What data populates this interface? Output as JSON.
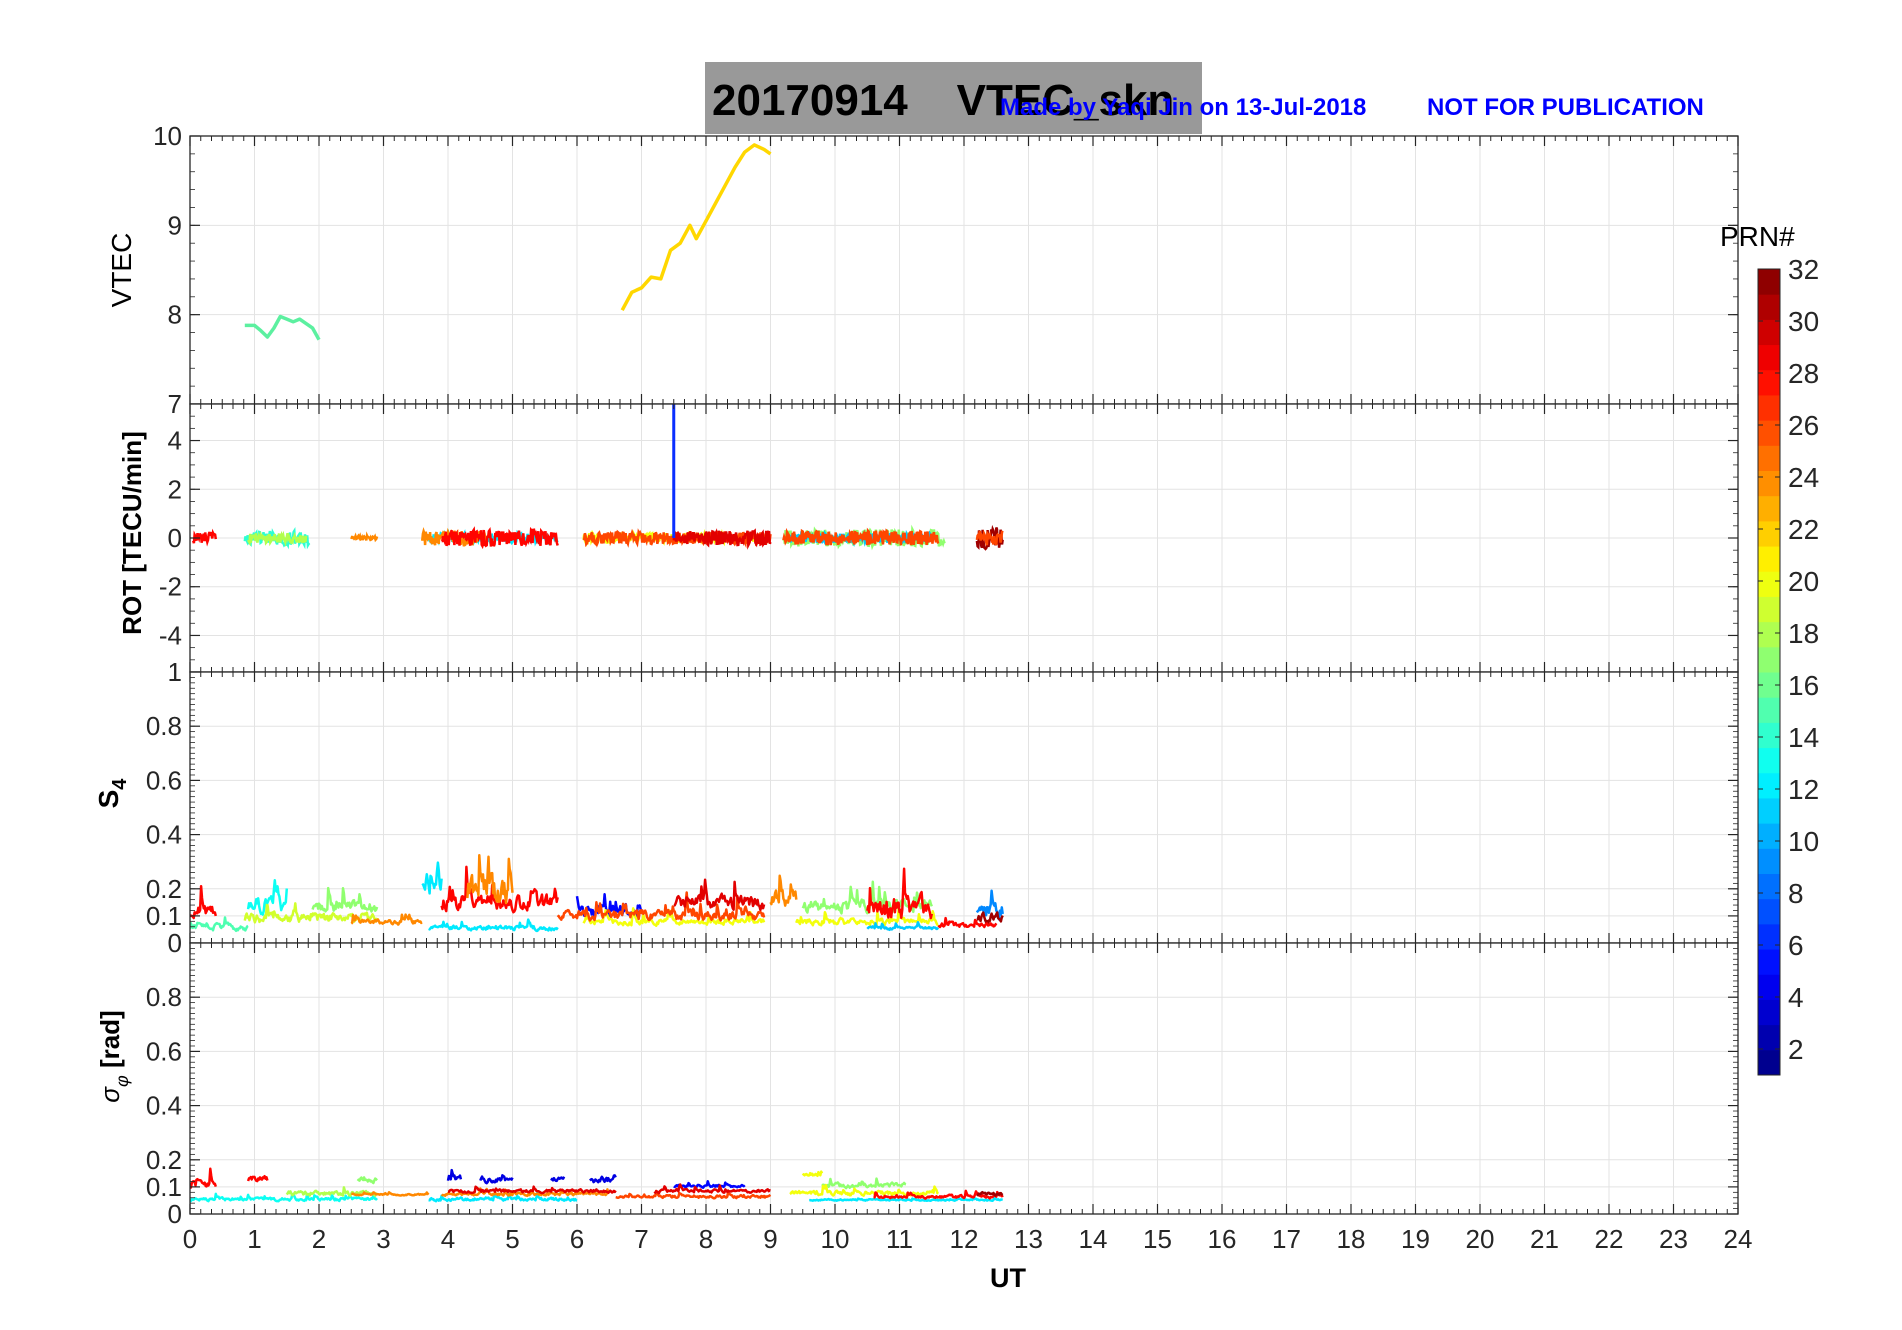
{
  "figure": {
    "title": "20170914    VTEC_skn",
    "credit": "Made by Yaqi Jin on 13-Jul-2018",
    "notice": "NOT FOR PUBLICATION",
    "xlabel": "UT"
  },
  "chart_data": [
    {
      "type": "line",
      "panel": "vtec",
      "ylabel": "VTEC",
      "xlim": [
        0,
        24
      ],
      "ylim": [
        7,
        10
      ],
      "yticks": [
        7,
        8,
        9,
        10
      ],
      "ytick_labels": [
        "7",
        "8",
        "9",
        "10"
      ],
      "grid": true,
      "series": [
        {
          "color": "#5cf0a0",
          "x": [
            0.85,
            1.0,
            1.1,
            1.2,
            1.3,
            1.4,
            1.5,
            1.6,
            1.7,
            1.8,
            1.9,
            2.0
          ],
          "y": [
            7.88,
            7.88,
            7.82,
            7.75,
            7.85,
            7.98,
            7.95,
            7.92,
            7.95,
            7.9,
            7.85,
            7.72
          ]
        },
        {
          "color": "#ffd700",
          "x": [
            6.7,
            6.85,
            7.0,
            7.15,
            7.3,
            7.45,
            7.6,
            7.75,
            7.85,
            8.0,
            8.15,
            8.3,
            8.45,
            8.6,
            8.75,
            8.9,
            9.0
          ],
          "y": [
            8.05,
            8.25,
            8.3,
            8.42,
            8.4,
            8.72,
            8.8,
            9.0,
            8.85,
            9.05,
            9.25,
            9.45,
            9.65,
            9.82,
            9.9,
            9.85,
            9.8
          ]
        }
      ]
    },
    {
      "type": "line",
      "panel": "rot",
      "ylabel": "ROT [TECU/min]",
      "xlim": [
        0,
        24
      ],
      "ylim": [
        -5.5,
        5.5
      ],
      "yticks": [
        -4,
        -2,
        0,
        2,
        4
      ],
      "ytick_labels": [
        "-4",
        "-2",
        "0",
        "2",
        "4"
      ],
      "grid": true,
      "segments": [
        {
          "x": [
            0.05,
            0.4
          ],
          "prn": 28,
          "amp": 0.25
        },
        {
          "x": [
            0.85,
            1.85
          ],
          "prn": 14,
          "amp": 0.3
        },
        {
          "x": [
            0.9,
            1.8
          ],
          "prn": 18,
          "amp": 0.2
        },
        {
          "x": [
            2.5,
            2.9
          ],
          "prn": 24,
          "amp": 0.1
        },
        {
          "x": [
            3.7,
            5.7
          ],
          "prn": 12,
          "amp": 0.2
        },
        {
          "x": [
            3.6,
            4.6
          ],
          "prn": 24,
          "amp": 0.3
        },
        {
          "x": [
            3.9,
            5.7
          ],
          "prn": 28,
          "amp": 0.35
        },
        {
          "x": [
            6.1,
            8.9
          ],
          "prn": 20,
          "amp": 0.2
        },
        {
          "x": [
            6.1,
            9.0
          ],
          "prn": 26,
          "amp": 0.25
        },
        {
          "x": [
            7.5,
            9.0
          ],
          "prn": 29,
          "amp": 0.3
        },
        {
          "x": [
            9.2,
            11.7
          ],
          "prn": 17,
          "amp": 0.35
        },
        {
          "x": [
            9.3,
            11.5
          ],
          "prn": 11,
          "amp": 0.2
        },
        {
          "x": [
            9.2,
            11.6
          ],
          "prn": 26,
          "amp": 0.3
        },
        {
          "x": [
            12.2,
            12.6
          ],
          "prn": 31,
          "amp": 0.45
        },
        {
          "x": [
            12.2,
            12.6
          ],
          "prn": 26,
          "amp": 0.3
        }
      ],
      "spikes": [
        {
          "x": 7.5,
          "y0": 0,
          "y1": 5.5,
          "color": "#0a2fff"
        }
      ]
    },
    {
      "type": "line",
      "panel": "s4",
      "ylabel": "S4",
      "xlim": [
        0,
        24
      ],
      "ylim": [
        0,
        1
      ],
      "yticks": [
        0,
        0.1,
        0.2,
        0.4,
        0.6,
        0.8,
        1
      ],
      "ytick_labels": [
        "0",
        "0.1",
        "0.2",
        "0.4",
        "0.6",
        "0.8",
        "1"
      ],
      "grid": true,
      "segments": [
        {
          "x": [
            0.0,
            0.4
          ],
          "prn": 28,
          "base": 0.1,
          "amp": 0.08
        },
        {
          "x": [
            0.0,
            0.9
          ],
          "prn": 15,
          "base": 0.05,
          "amp": 0.04
        },
        {
          "x": [
            0.85,
            2.9
          ],
          "prn": 19,
          "base": 0.08,
          "amp": 0.06
        },
        {
          "x": [
            0.9,
            1.5
          ],
          "prn": 13,
          "base": 0.12,
          "amp": 0.1
        },
        {
          "x": [
            1.9,
            2.9
          ],
          "prn": 17,
          "base": 0.12,
          "amp": 0.07
        },
        {
          "x": [
            2.5,
            3.6
          ],
          "prn": 24,
          "base": 0.07,
          "amp": 0.03
        },
        {
          "x": [
            3.6,
            3.9
          ],
          "prn": 12,
          "base": 0.2,
          "amp": 0.2
        },
        {
          "x": [
            3.7,
            5.7
          ],
          "prn": 12,
          "base": 0.05,
          "amp": 0.03
        },
        {
          "x": [
            3.9,
            5.7
          ],
          "prn": 28,
          "base": 0.13,
          "amp": 0.1
        },
        {
          "x": [
            4.3,
            5.0
          ],
          "prn": 24,
          "base": 0.15,
          "amp": 0.2
        },
        {
          "x": [
            6.0,
            7.0
          ],
          "prn": 5,
          "base": 0.1,
          "amp": 0.08
        },
        {
          "x": [
            6.1,
            8.9
          ],
          "prn": 20,
          "base": 0.07,
          "amp": 0.04
        },
        {
          "x": [
            5.7,
            8.9
          ],
          "prn": 26,
          "base": 0.09,
          "amp": 0.06
        },
        {
          "x": [
            7.5,
            8.9
          ],
          "prn": 29,
          "base": 0.13,
          "amp": 0.09
        },
        {
          "x": [
            9.0,
            9.4
          ],
          "prn": 24,
          "base": 0.14,
          "amp": 0.1
        },
        {
          "x": [
            9.5,
            11.5
          ],
          "prn": 17,
          "base": 0.12,
          "amp": 0.08
        },
        {
          "x": [
            9.4,
            11.6
          ],
          "prn": 20,
          "base": 0.07,
          "amp": 0.04
        },
        {
          "x": [
            10.5,
            11.6
          ],
          "prn": 11,
          "base": 0.05,
          "amp": 0.02
        },
        {
          "x": [
            10.5,
            11.5
          ],
          "prn": 28,
          "base": 0.1,
          "amp": 0.15
        },
        {
          "x": [
            12.2,
            12.6
          ],
          "prn": 9,
          "base": 0.1,
          "amp": 0.1
        },
        {
          "x": [
            12.2,
            12.6
          ],
          "prn": 31,
          "base": 0.08,
          "amp": 0.06
        },
        {
          "x": [
            11.6,
            12.5
          ],
          "prn": 28,
          "base": 0.06,
          "amp": 0.03
        }
      ]
    },
    {
      "type": "line",
      "panel": "sigma_phi",
      "ylabel": "σφ [rad]",
      "xlim": [
        0,
        24
      ],
      "ylim": [
        0,
        1
      ],
      "yticks": [
        0,
        0.1,
        0.2,
        0.4,
        0.6,
        0.8
      ],
      "ytick_labels": [
        "0",
        "0.1",
        "0.2",
        "0.4",
        "0.6",
        "0.8"
      ],
      "grid": true,
      "segments": [
        {
          "x": [
            0.0,
            0.4
          ],
          "prn": 28,
          "base": 0.1,
          "amp": 0.05
        },
        {
          "x": [
            0.0,
            2.9
          ],
          "prn": 13,
          "base": 0.05,
          "amp": 0.02
        },
        {
          "x": [
            0.9,
            1.2
          ],
          "prn": 28,
          "base": 0.12,
          "amp": 0.04
        },
        {
          "x": [
            1.5,
            2.9
          ],
          "prn": 18,
          "base": 0.07,
          "amp": 0.03
        },
        {
          "x": [
            2.6,
            2.9
          ],
          "prn": 17,
          "base": 0.12,
          "amp": 0.04
        },
        {
          "x": [
            2.5,
            3.7
          ],
          "prn": 24,
          "base": 0.07,
          "amp": 0.01
        },
        {
          "x": [
            3.7,
            6.0
          ],
          "prn": 12,
          "base": 0.05,
          "amp": 0.02
        },
        {
          "x": [
            3.9,
            6.5
          ],
          "prn": 24,
          "base": 0.07,
          "amp": 0.02
        },
        {
          "x": [
            4.0,
            4.2
          ],
          "prn": 4,
          "base": 0.12,
          "amp": 0.04
        },
        {
          "x": [
            4.5,
            5.0
          ],
          "prn": 4,
          "base": 0.12,
          "amp": 0.04
        },
        {
          "x": [
            5.6,
            5.8
          ],
          "prn": 4,
          "base": 0.12,
          "amp": 0.04
        },
        {
          "x": [
            6.2,
            6.6
          ],
          "prn": 4,
          "base": 0.12,
          "amp": 0.04
        },
        {
          "x": [
            4.0,
            6.6
          ],
          "prn": 29,
          "base": 0.08,
          "amp": 0.02
        },
        {
          "x": [
            6.6,
            9.0
          ],
          "prn": 26,
          "base": 0.06,
          "amp": 0.02
        },
        {
          "x": [
            7.5,
            8.6
          ],
          "prn": 5,
          "base": 0.1,
          "amp": 0.02
        },
        {
          "x": [
            7.2,
            9.0
          ],
          "prn": 29,
          "base": 0.08,
          "amp": 0.02
        },
        {
          "x": [
            9.5,
            9.8
          ],
          "prn": 20,
          "base": 0.14,
          "amp": 0.02
        },
        {
          "x": [
            9.8,
            11.1
          ],
          "prn": 17,
          "base": 0.1,
          "amp": 0.03
        },
        {
          "x": [
            9.3,
            11.6
          ],
          "prn": 20,
          "base": 0.07,
          "amp": 0.03
        },
        {
          "x": [
            9.6,
            12.6
          ],
          "prn": 12,
          "base": 0.05,
          "amp": 0.01
        },
        {
          "x": [
            10.6,
            12.6
          ],
          "prn": 28,
          "base": 0.06,
          "amp": 0.02
        },
        {
          "x": [
            12.2,
            12.6
          ],
          "prn": 31,
          "base": 0.07,
          "amp": 0.02
        }
      ]
    }
  ],
  "xaxis": {
    "ticks": [
      0,
      1,
      2,
      3,
      4,
      5,
      6,
      7,
      8,
      9,
      10,
      11,
      12,
      13,
      14,
      15,
      16,
      17,
      18,
      19,
      20,
      21,
      22,
      23,
      24
    ],
    "tick_labels": [
      "0",
      "1",
      "2",
      "3",
      "4",
      "5",
      "6",
      "7",
      "8",
      "9",
      "10",
      "11",
      "12",
      "13",
      "14",
      "15",
      "16",
      "17",
      "18",
      "19",
      "20",
      "21",
      "22",
      "23",
      "24"
    ]
  },
  "colorbar": {
    "label": "PRN#",
    "range": [
      1,
      32
    ],
    "ticks": [
      2,
      4,
      6,
      8,
      10,
      12,
      14,
      16,
      18,
      20,
      22,
      24,
      26,
      28,
      30,
      32
    ],
    "tick_labels": [
      "2",
      "4",
      "6",
      "8",
      "10",
      "12",
      "14",
      "16",
      "18",
      "20",
      "22",
      "24",
      "26",
      "28",
      "30",
      "32"
    ],
    "colormap": "jet"
  }
}
